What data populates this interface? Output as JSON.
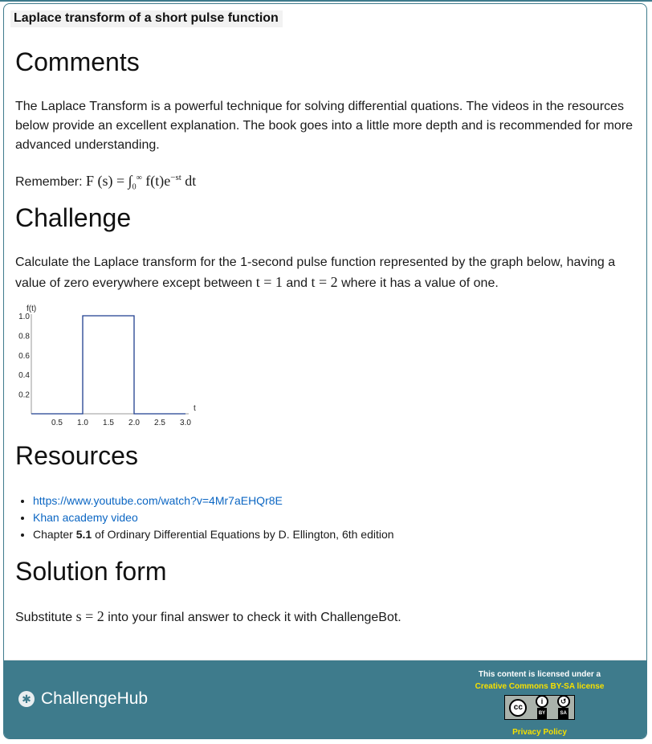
{
  "title": "Laplace transform of a short pulse function",
  "comments": {
    "heading": "Comments",
    "paragraph": "The Laplace Transform is a powerful technique for solving differential quations. The videos in the resources below provide an excellent explanation. The book goes into a little more depth and is recommended for more advanced understanding.",
    "remember_label": "Remember:"
  },
  "challenge": {
    "heading": "Challenge",
    "text_before": "Calculate the Laplace transform for the 1-second pulse function represented by the graph below, having a value of zero everywhere except between",
    "text_and": "and",
    "text_after": "where it has a value of one."
  },
  "chart_data": {
    "type": "line",
    "ylabel": "f(t)",
    "xlabel": "t",
    "x_ticks": [
      "0.5",
      "1.0",
      "1.5",
      "2.0",
      "2.5",
      "3.0"
    ],
    "y_ticks": [
      "0.2",
      "0.4",
      "0.6",
      "0.8",
      "1.0"
    ],
    "xlim": [
      0,
      3.0
    ],
    "ylim": [
      0,
      1.0
    ],
    "x": [
      0,
      1,
      1,
      2,
      2,
      3
    ],
    "y": [
      0,
      0,
      1,
      1,
      0,
      0
    ],
    "color": "#1f3f8f"
  },
  "resources": {
    "heading": "Resources",
    "link1": "https://www.youtube.com/watch?v=4Mr7aEHQr8E",
    "link2": "Khan academy video",
    "book_prefix": "Chapter",
    "book_chapter": "5.1",
    "book_suffix": "of Ordinary Differential Equations by D. Ellington, 6th edition"
  },
  "solution": {
    "heading": "Solution form",
    "text_before": "Substitute",
    "text_after": "into your final answer to check it with ChallengeBot."
  },
  "footer": {
    "brand": "ChallengeHub",
    "license_text": "This content is licensed under a",
    "license_link": "Creative Commons BY-SA license",
    "cc_by": "BY",
    "cc_sa": "SA",
    "privacy": "Privacy Policy"
  },
  "colors": {
    "accent": "#3e7b8c",
    "link": "#0b66c3",
    "footer_link": "#f6e000"
  }
}
